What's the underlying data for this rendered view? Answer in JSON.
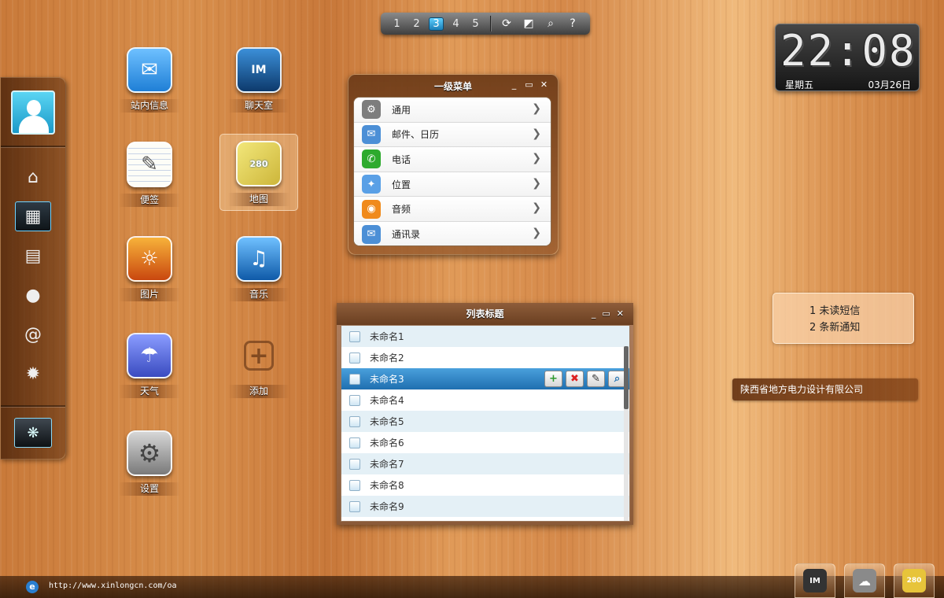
{
  "pager": {
    "pages": [
      "1",
      "2",
      "3",
      "4",
      "5"
    ],
    "active_page": "3",
    "tools": [
      {
        "name": "refresh-icon",
        "glyph": "⟳"
      },
      {
        "name": "fullscreen-icon",
        "glyph": "◩"
      },
      {
        "name": "search-icon",
        "glyph": "⌕"
      },
      {
        "name": "help-icon",
        "glyph": "?"
      }
    ]
  },
  "dock": {
    "items": [
      {
        "name": "home-icon",
        "glyph": "⌂"
      },
      {
        "name": "apps-grid-icon",
        "glyph": "▦"
      },
      {
        "name": "contact-card-icon",
        "glyph": "▤"
      },
      {
        "name": "chat-icon",
        "glyph": "●"
      },
      {
        "name": "at-icon",
        "glyph": "@"
      },
      {
        "name": "gear-icon",
        "glyph": "✹"
      }
    ]
  },
  "apps": [
    {
      "label": "站内信息",
      "icon": "mail-icon",
      "glyph": "✉",
      "color": "#3e9be6"
    },
    {
      "label": "聊天室",
      "icon": "im-icon",
      "glyph": "IM",
      "color": "#1a5f9c"
    },
    {
      "label": "便签",
      "icon": "notes-icon",
      "glyph": "✎",
      "color": "#f4f4ec"
    },
    {
      "label": "地图",
      "icon": "map-icon",
      "glyph": "280",
      "color": "#e7d64a"
    },
    {
      "label": "图片",
      "icon": "photo-icon",
      "glyph": "☼",
      "color": "#e27a1f"
    },
    {
      "label": "音乐",
      "icon": "music-icon",
      "glyph": "♫",
      "color": "#2a87d8"
    },
    {
      "label": "天气",
      "icon": "weather-icon",
      "glyph": "☂",
      "color": "#5b6fd6"
    },
    {
      "label": "添加",
      "icon": "add-icon",
      "glyph": "+",
      "color": "transparent"
    },
    {
      "label": "设置",
      "icon": "settings-icon",
      "glyph": "⚙",
      "color": "#9a9a9a"
    }
  ],
  "clock": {
    "time": "22:08",
    "day": "星期五",
    "date": "03月26日"
  },
  "menu_panel": {
    "title": "一级菜单",
    "controls": [
      "_",
      "▭",
      "✕"
    ],
    "items": [
      {
        "label": "通用",
        "icon": "general-icon",
        "glyph": "⚙",
        "color": "#7d7d7d"
      },
      {
        "label": "邮件、日历",
        "icon": "mail-icon",
        "glyph": "✉",
        "color": "#4c8fd6"
      },
      {
        "label": "电话",
        "icon": "phone-icon",
        "glyph": "✆",
        "color": "#2eaa2e"
      },
      {
        "label": "位置",
        "icon": "location-icon",
        "glyph": "✦",
        "color": "#5aa0e6"
      },
      {
        "label": "音频",
        "icon": "audio-icon",
        "glyph": "◉",
        "color": "#f08a1c"
      },
      {
        "label": "通讯录",
        "icon": "contacts-icon",
        "glyph": "✉",
        "color": "#4c8fd6"
      }
    ]
  },
  "list_panel": {
    "title": "列表标题",
    "controls": [
      "_",
      "▭",
      "✕"
    ],
    "rows": [
      "未命名1",
      "未命名2",
      "未命名3",
      "未命名4",
      "未命名5",
      "未命名6",
      "未命名7",
      "未命名8",
      "未命名9"
    ],
    "selected_row": "未命名3",
    "row_actions": [
      {
        "name": "add-icon",
        "glyph": "+",
        "color": "#2e9a2e"
      },
      {
        "name": "delete-icon",
        "glyph": "✖",
        "color": "#d22"
      },
      {
        "name": "edit-icon",
        "glyph": "✎",
        "color": "#333"
      },
      {
        "name": "search-icon",
        "glyph": "⌕",
        "color": "#1f6fb0"
      }
    ]
  },
  "notification": {
    "line1": "1 未读短信",
    "line2": "2 条新通知"
  },
  "company": "陕西省地方电力设计有限公司",
  "statusbar": {
    "url": "http://www.xinlongcn.com/oa"
  },
  "tray": [
    {
      "name": "im-tray-icon",
      "glyph": "IM",
      "color": "#333"
    },
    {
      "name": "weather-tray-icon",
      "glyph": "☁",
      "color": "#8a8a8a"
    },
    {
      "name": "map-tray-icon",
      "glyph": "280",
      "color": "#e7c43a"
    }
  ]
}
